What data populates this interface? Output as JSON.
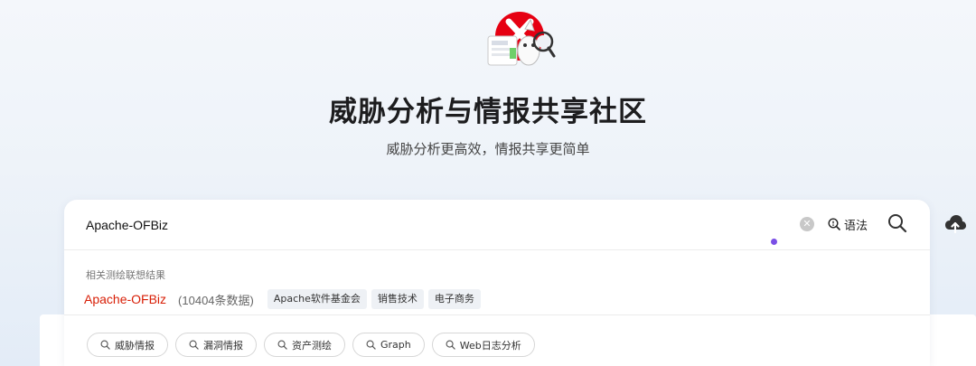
{
  "hero": {
    "title": "威胁分析与情报共享社区",
    "subtitle": "威胁分析更高效，情报共享更简单"
  },
  "search": {
    "value": "Apache-OFBiz",
    "syntax_label": "语法"
  },
  "suggestions": {
    "heading": "相关测绘联想结果",
    "term": "Apache-OFBiz",
    "count": "(10404条数据)",
    "tags": [
      "Apache软件基金会",
      "销售技术",
      "电子商务"
    ]
  },
  "quick_links": [
    "威胁情报",
    "漏洞情报",
    "资产测绘",
    "Graph",
    "Web日志分析"
  ],
  "icons": {
    "logo": "mascot-logo-icon",
    "clear": "clear-icon",
    "syntax": "syntax-help-icon",
    "search": "search-icon",
    "upload": "cloud-upload-icon",
    "quick": "search-icon"
  },
  "colors": {
    "accent_red": "#d81e06",
    "brand_red": "#e60012",
    "loading_dot": "#7a4fe6"
  }
}
